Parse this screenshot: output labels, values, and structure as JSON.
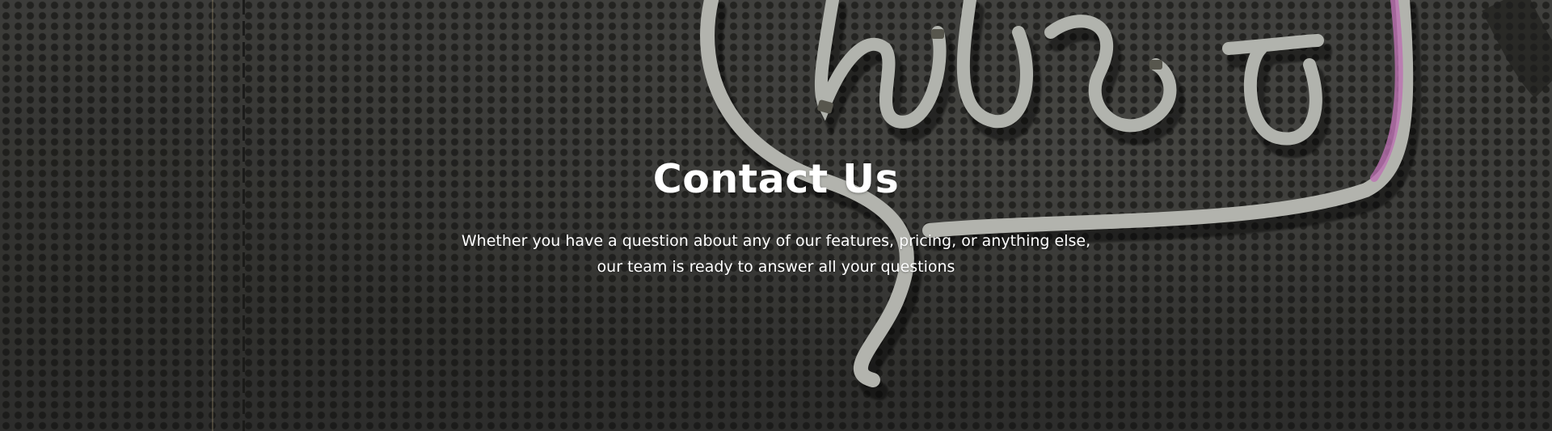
{
  "hero": {
    "title": "Contact Us",
    "subtitle_line1": "Whether you have a question about any of our features, pricing, or anything else,",
    "subtitle_line2": "our team is ready to answer all your questions"
  },
  "colors": {
    "text": "#ffffff",
    "background": "#3e3e3b",
    "neon_white": "#d8dbd3",
    "neon_pink": "#e58ad8"
  }
}
